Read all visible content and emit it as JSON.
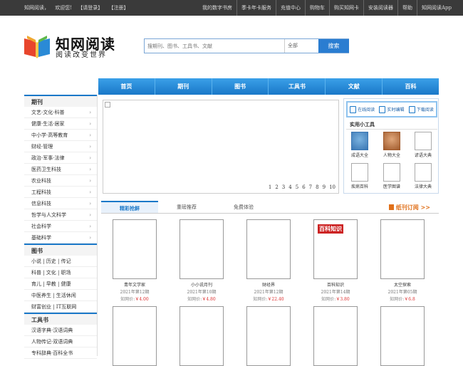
{
  "topbar": {
    "left": [
      "知网阅读，",
      "欢迎您!",
      "【请登录】",
      "【注册】"
    ],
    "links": [
      "我的数字书房",
      "季卡年卡服务",
      "充值中心",
      "购物车",
      "购买知网卡",
      "安装阅读器",
      "帮助",
      "知网阅读App"
    ]
  },
  "logo": {
    "title": "知网阅读",
    "slogan": "阅读改变世界"
  },
  "search": {
    "placeholder": "搜期刊、图书、工具书、文献",
    "scope": "全部",
    "button": "搜索"
  },
  "nav": [
    "首页",
    "期刊",
    "图书",
    "工具书",
    "文献",
    "百科"
  ],
  "sidebar": {
    "sections": [
      {
        "title": "期刊",
        "items": [
          "文艺·文化·科普",
          "健康·生活·居家",
          "中小学·高等教育",
          "财经·管理",
          "政治·军事·法律",
          "医药卫生科技",
          "农业科技",
          "工程科技",
          "信息科技",
          "哲学与人文科学",
          "社会科学",
          "基础科学"
        ],
        "arrows": true
      },
      {
        "title": "图书",
        "items": [
          "小说 | 历史 | 传记",
          "科普 | 文化 | 职场",
          "育儿 | 早教 | 健康",
          "中医养生 | 生活休闲",
          "财富创业 | IT互联网"
        ],
        "arrows": false
      },
      {
        "title": "工具书",
        "items": [
          "汉语字典·汉语词典",
          "人物传记·双语词典",
          "专科辞典·百科全书"
        ],
        "arrows": false
      }
    ]
  },
  "pager": [
    "1",
    "2",
    "3",
    "4",
    "5",
    "6",
    "7",
    "8",
    "9",
    "10"
  ],
  "tools": {
    "top": [
      "在线阅读",
      "实时编辑",
      "下载阅读"
    ],
    "title": "实用小工具",
    "items": [
      "成语大全",
      "人物大全",
      "谚语大典",
      "疾病百科",
      "医学图谱",
      "法律大典"
    ]
  },
  "tabs": {
    "items": [
      "精彩抢鲜",
      "重磅推荐",
      "免费体验"
    ],
    "more": "纸刊订阅 >>"
  },
  "books": [
    {
      "name": "青年文学家",
      "date": "2021年第12期",
      "price_label": "知网价:",
      "price": "￥4.00"
    },
    {
      "name": "小小说月刊",
      "date": "2021年第10期",
      "price_label": "知网价:",
      "price": "￥4.80",
      "cover_text": "小小说月刊"
    },
    {
      "name": "财经界",
      "date": "2021年第12期",
      "price_label": "知网价:",
      "price": "￥22.40",
      "cover_text": "财经界"
    },
    {
      "name": "百科知识",
      "date": "2021年第14期",
      "price_label": "知网价:",
      "price": "￥3.80",
      "cover_text": "百科知识"
    },
    {
      "name": "太空探索",
      "date": "2021年第05期",
      "price_label": "知网价:",
      "price": "￥6.8",
      "cover_text": "太空探索"
    }
  ]
}
